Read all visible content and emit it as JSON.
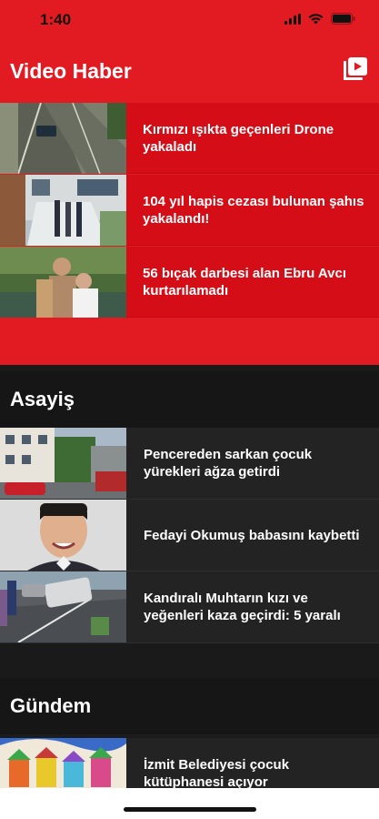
{
  "status_bar": {
    "time": "1:40"
  },
  "header": {
    "title": "Video Haber",
    "icon": "video-library-icon"
  },
  "video_news": [
    {
      "title": "Kırmızı ışıkta geçenleri Drone yakaladı"
    },
    {
      "title": "104 yıl hapis cezası bulunan şahıs yakalandı!"
    },
    {
      "title": "56 bıçak darbesi alan Ebru Avcı kurtarılamadı"
    }
  ],
  "sections": [
    {
      "title": "Asayiş",
      "items": [
        {
          "title": "Pencereden sarkan çocuk yürekleri ağza getirdi"
        },
        {
          "title": "Fedayi Okumuş babasını kaybetti"
        },
        {
          "title": "Kandıralı Muhtarın kızı ve yeğenleri kaza geçirdi: 5 yaralı"
        }
      ]
    },
    {
      "title": "Gündem",
      "items": [
        {
          "title": "İzmit Belediyesi çocuk kütüphanesi açıyor"
        }
      ]
    }
  ],
  "colors": {
    "brand_red": "#e21b23",
    "dark_bg": "#1c1c1c",
    "row_bg": "#232323"
  }
}
